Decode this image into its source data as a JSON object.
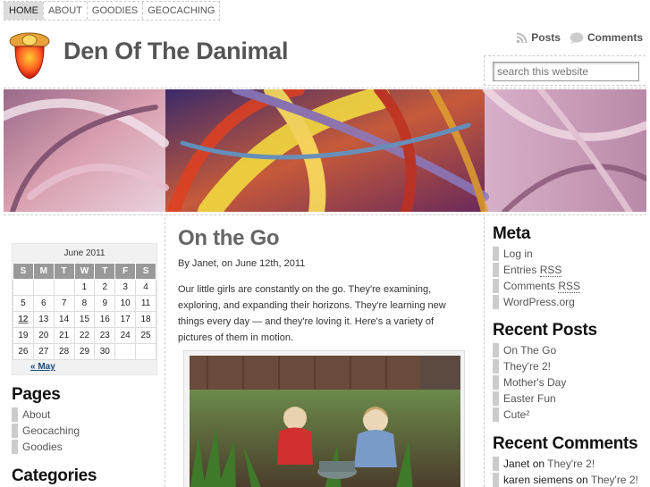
{
  "nav": {
    "items": [
      {
        "label": "HOME",
        "active": true
      },
      {
        "label": "ABOUT",
        "active": false
      },
      {
        "label": "GOODIES",
        "active": false
      },
      {
        "label": "GEOCACHING",
        "active": false
      }
    ]
  },
  "header": {
    "title": "Den Of The Danimal",
    "posts_label": "Posts",
    "comments_label": "Comments",
    "search_placeholder": "search this website"
  },
  "calendar": {
    "caption": "June 2011",
    "weekdays": [
      "S",
      "M",
      "T",
      "W",
      "T",
      "F",
      "S"
    ],
    "weeks": [
      [
        "",
        "",
        "",
        "1",
        "2",
        "3",
        "4"
      ],
      [
        "5",
        "6",
        "7",
        "8",
        "9",
        "10",
        "11"
      ],
      [
        "12",
        "13",
        "14",
        "15",
        "16",
        "17",
        "18"
      ],
      [
        "19",
        "20",
        "21",
        "22",
        "23",
        "24",
        "25"
      ],
      [
        "26",
        "27",
        "28",
        "29",
        "30",
        "",
        ""
      ]
    ],
    "linked_day": "12",
    "prev_label": "« May"
  },
  "pages": {
    "title": "Pages",
    "items": [
      "About",
      "Geocaching",
      "Goodies"
    ]
  },
  "categories": {
    "title": "Categories"
  },
  "post": {
    "title": "On the Go",
    "byline": "By Janet, on June 12th, 2011",
    "body": "Our little girls are constantly on the go. They're examining, exploring, and expanding their horizons. They're learning new things every day — and they're loving it. Here's a variety of pictures of them in motion."
  },
  "meta": {
    "title": "Meta",
    "items": [
      {
        "text": "Log in"
      },
      {
        "text": "Entries ",
        "abbr": "RSS"
      },
      {
        "text": "Comments ",
        "abbr": "RSS"
      },
      {
        "text": "WordPress.org"
      }
    ]
  },
  "recent_posts": {
    "title": "Recent Posts",
    "items": [
      "On The Go",
      "They're 2!",
      "Mother's Day",
      "Easter Fun",
      "Cute²"
    ]
  },
  "recent_comments": {
    "title": "Recent Comments",
    "items": [
      {
        "author": "Janet",
        "on": " on ",
        "post": "They're 2!"
      },
      {
        "author": "karen siemens",
        "on": " on ",
        "post": "They're 2!"
      }
    ]
  },
  "colors": {
    "accent": "#555555",
    "sidebar_bar": "#cccccc",
    "calendar_header": "#999999",
    "link_blue": "#1a4c7a"
  }
}
